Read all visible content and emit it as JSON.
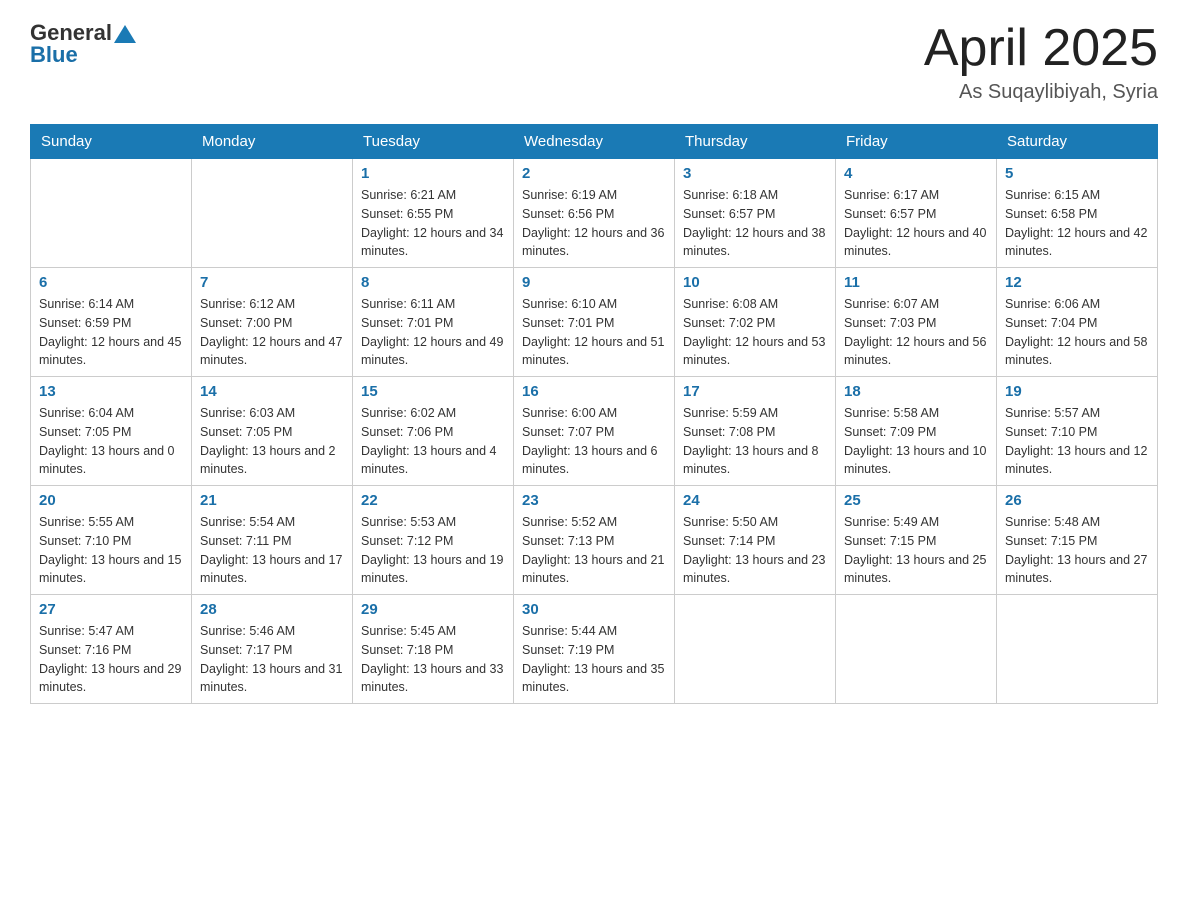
{
  "header": {
    "logo_general": "General",
    "logo_blue": "Blue",
    "main_title": "April 2025",
    "subtitle": "As Suqaylibiyah, Syria"
  },
  "calendar": {
    "days_of_week": [
      "Sunday",
      "Monday",
      "Tuesday",
      "Wednesday",
      "Thursday",
      "Friday",
      "Saturday"
    ],
    "weeks": [
      [
        {
          "day": "",
          "sunrise": "",
          "sunset": "",
          "daylight": ""
        },
        {
          "day": "",
          "sunrise": "",
          "sunset": "",
          "daylight": ""
        },
        {
          "day": "1",
          "sunrise": "Sunrise: 6:21 AM",
          "sunset": "Sunset: 6:55 PM",
          "daylight": "Daylight: 12 hours and 34 minutes."
        },
        {
          "day": "2",
          "sunrise": "Sunrise: 6:19 AM",
          "sunset": "Sunset: 6:56 PM",
          "daylight": "Daylight: 12 hours and 36 minutes."
        },
        {
          "day": "3",
          "sunrise": "Sunrise: 6:18 AM",
          "sunset": "Sunset: 6:57 PM",
          "daylight": "Daylight: 12 hours and 38 minutes."
        },
        {
          "day": "4",
          "sunrise": "Sunrise: 6:17 AM",
          "sunset": "Sunset: 6:57 PM",
          "daylight": "Daylight: 12 hours and 40 minutes."
        },
        {
          "day": "5",
          "sunrise": "Sunrise: 6:15 AM",
          "sunset": "Sunset: 6:58 PM",
          "daylight": "Daylight: 12 hours and 42 minutes."
        }
      ],
      [
        {
          "day": "6",
          "sunrise": "Sunrise: 6:14 AM",
          "sunset": "Sunset: 6:59 PM",
          "daylight": "Daylight: 12 hours and 45 minutes."
        },
        {
          "day": "7",
          "sunrise": "Sunrise: 6:12 AM",
          "sunset": "Sunset: 7:00 PM",
          "daylight": "Daylight: 12 hours and 47 minutes."
        },
        {
          "day": "8",
          "sunrise": "Sunrise: 6:11 AM",
          "sunset": "Sunset: 7:01 PM",
          "daylight": "Daylight: 12 hours and 49 minutes."
        },
        {
          "day": "9",
          "sunrise": "Sunrise: 6:10 AM",
          "sunset": "Sunset: 7:01 PM",
          "daylight": "Daylight: 12 hours and 51 minutes."
        },
        {
          "day": "10",
          "sunrise": "Sunrise: 6:08 AM",
          "sunset": "Sunset: 7:02 PM",
          "daylight": "Daylight: 12 hours and 53 minutes."
        },
        {
          "day": "11",
          "sunrise": "Sunrise: 6:07 AM",
          "sunset": "Sunset: 7:03 PM",
          "daylight": "Daylight: 12 hours and 56 minutes."
        },
        {
          "day": "12",
          "sunrise": "Sunrise: 6:06 AM",
          "sunset": "Sunset: 7:04 PM",
          "daylight": "Daylight: 12 hours and 58 minutes."
        }
      ],
      [
        {
          "day": "13",
          "sunrise": "Sunrise: 6:04 AM",
          "sunset": "Sunset: 7:05 PM",
          "daylight": "Daylight: 13 hours and 0 minutes."
        },
        {
          "day": "14",
          "sunrise": "Sunrise: 6:03 AM",
          "sunset": "Sunset: 7:05 PM",
          "daylight": "Daylight: 13 hours and 2 minutes."
        },
        {
          "day": "15",
          "sunrise": "Sunrise: 6:02 AM",
          "sunset": "Sunset: 7:06 PM",
          "daylight": "Daylight: 13 hours and 4 minutes."
        },
        {
          "day": "16",
          "sunrise": "Sunrise: 6:00 AM",
          "sunset": "Sunset: 7:07 PM",
          "daylight": "Daylight: 13 hours and 6 minutes."
        },
        {
          "day": "17",
          "sunrise": "Sunrise: 5:59 AM",
          "sunset": "Sunset: 7:08 PM",
          "daylight": "Daylight: 13 hours and 8 minutes."
        },
        {
          "day": "18",
          "sunrise": "Sunrise: 5:58 AM",
          "sunset": "Sunset: 7:09 PM",
          "daylight": "Daylight: 13 hours and 10 minutes."
        },
        {
          "day": "19",
          "sunrise": "Sunrise: 5:57 AM",
          "sunset": "Sunset: 7:10 PM",
          "daylight": "Daylight: 13 hours and 12 minutes."
        }
      ],
      [
        {
          "day": "20",
          "sunrise": "Sunrise: 5:55 AM",
          "sunset": "Sunset: 7:10 PM",
          "daylight": "Daylight: 13 hours and 15 minutes."
        },
        {
          "day": "21",
          "sunrise": "Sunrise: 5:54 AM",
          "sunset": "Sunset: 7:11 PM",
          "daylight": "Daylight: 13 hours and 17 minutes."
        },
        {
          "day": "22",
          "sunrise": "Sunrise: 5:53 AM",
          "sunset": "Sunset: 7:12 PM",
          "daylight": "Daylight: 13 hours and 19 minutes."
        },
        {
          "day": "23",
          "sunrise": "Sunrise: 5:52 AM",
          "sunset": "Sunset: 7:13 PM",
          "daylight": "Daylight: 13 hours and 21 minutes."
        },
        {
          "day": "24",
          "sunrise": "Sunrise: 5:50 AM",
          "sunset": "Sunset: 7:14 PM",
          "daylight": "Daylight: 13 hours and 23 minutes."
        },
        {
          "day": "25",
          "sunrise": "Sunrise: 5:49 AM",
          "sunset": "Sunset: 7:15 PM",
          "daylight": "Daylight: 13 hours and 25 minutes."
        },
        {
          "day": "26",
          "sunrise": "Sunrise: 5:48 AM",
          "sunset": "Sunset: 7:15 PM",
          "daylight": "Daylight: 13 hours and 27 minutes."
        }
      ],
      [
        {
          "day": "27",
          "sunrise": "Sunrise: 5:47 AM",
          "sunset": "Sunset: 7:16 PM",
          "daylight": "Daylight: 13 hours and 29 minutes."
        },
        {
          "day": "28",
          "sunrise": "Sunrise: 5:46 AM",
          "sunset": "Sunset: 7:17 PM",
          "daylight": "Daylight: 13 hours and 31 minutes."
        },
        {
          "day": "29",
          "sunrise": "Sunrise: 5:45 AM",
          "sunset": "Sunset: 7:18 PM",
          "daylight": "Daylight: 13 hours and 33 minutes."
        },
        {
          "day": "30",
          "sunrise": "Sunrise: 5:44 AM",
          "sunset": "Sunset: 7:19 PM",
          "daylight": "Daylight: 13 hours and 35 minutes."
        },
        {
          "day": "",
          "sunrise": "",
          "sunset": "",
          "daylight": ""
        },
        {
          "day": "",
          "sunrise": "",
          "sunset": "",
          "daylight": ""
        },
        {
          "day": "",
          "sunrise": "",
          "sunset": "",
          "daylight": ""
        }
      ]
    ]
  }
}
